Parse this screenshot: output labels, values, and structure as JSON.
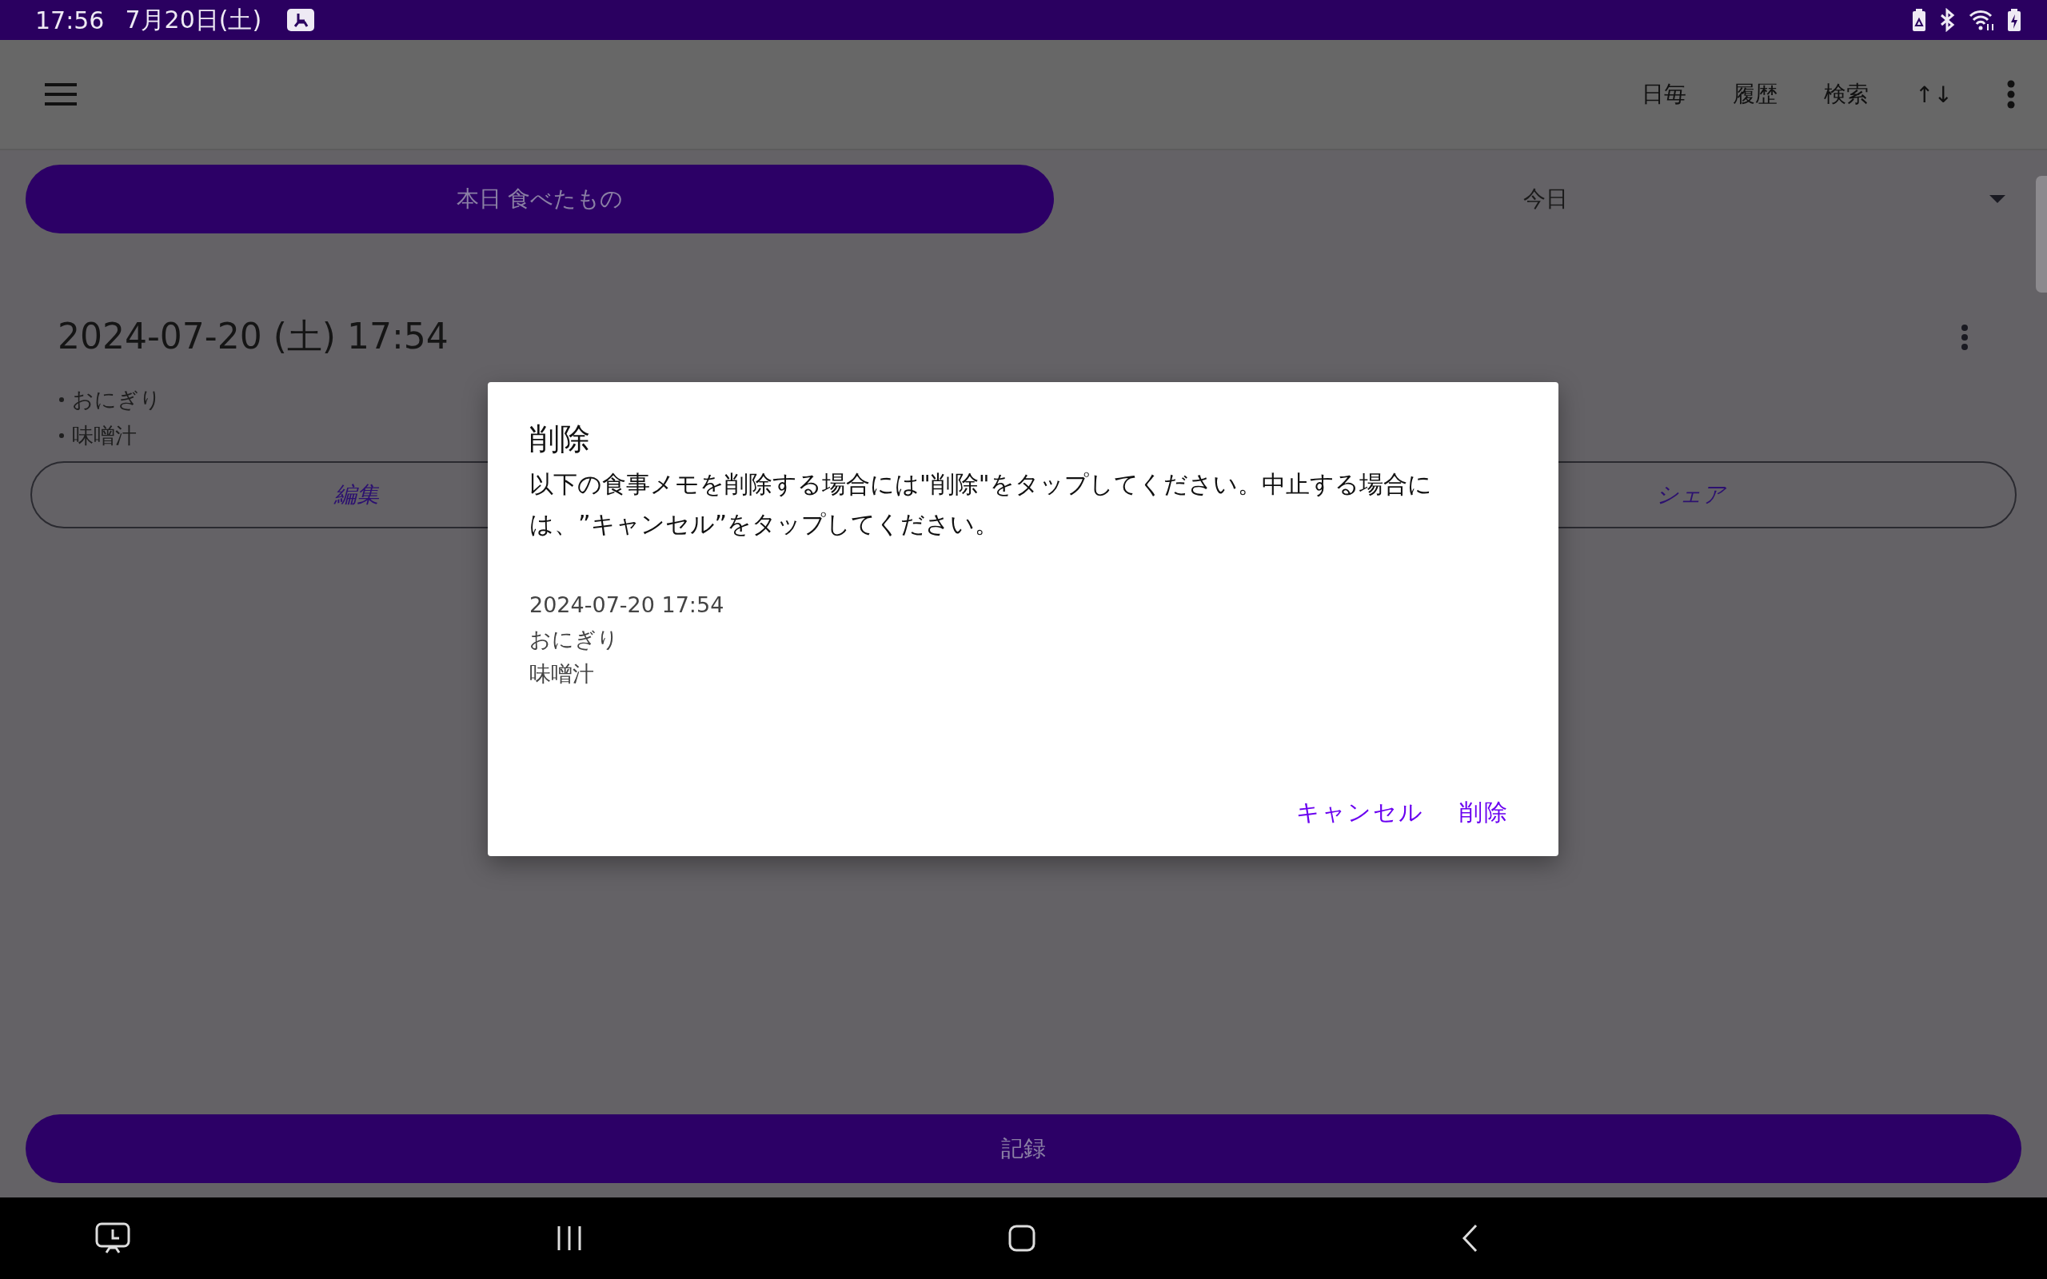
{
  "status_bar": {
    "time": "17:56",
    "date": "7月20日(土)"
  },
  "app_bar": {
    "actions": [
      "日毎",
      "履歴",
      "検索",
      "↑↓"
    ]
  },
  "summary_button": {
    "label": "本日 食べたもの"
  },
  "period_select": {
    "value": "今日"
  },
  "entry": {
    "title": "2024-07-20 (土) 17:54",
    "items": [
      "おにぎり",
      "味噌汁"
    ],
    "buttons": [
      {
        "label": "編集"
      },
      {
        "label": "シェア"
      }
    ]
  },
  "record_button": {
    "label": "記録"
  },
  "dialog": {
    "title": "削除",
    "message": "以下の食事メモを削除する場合には\"削除\"をタップしてください。中止する場合には、”キャンセル”をタップしてください。",
    "details": [
      "2024-07-20 17:54",
      "おにぎり",
      "味噌汁"
    ],
    "buttons": [
      "キャンセル",
      "削除"
    ]
  }
}
